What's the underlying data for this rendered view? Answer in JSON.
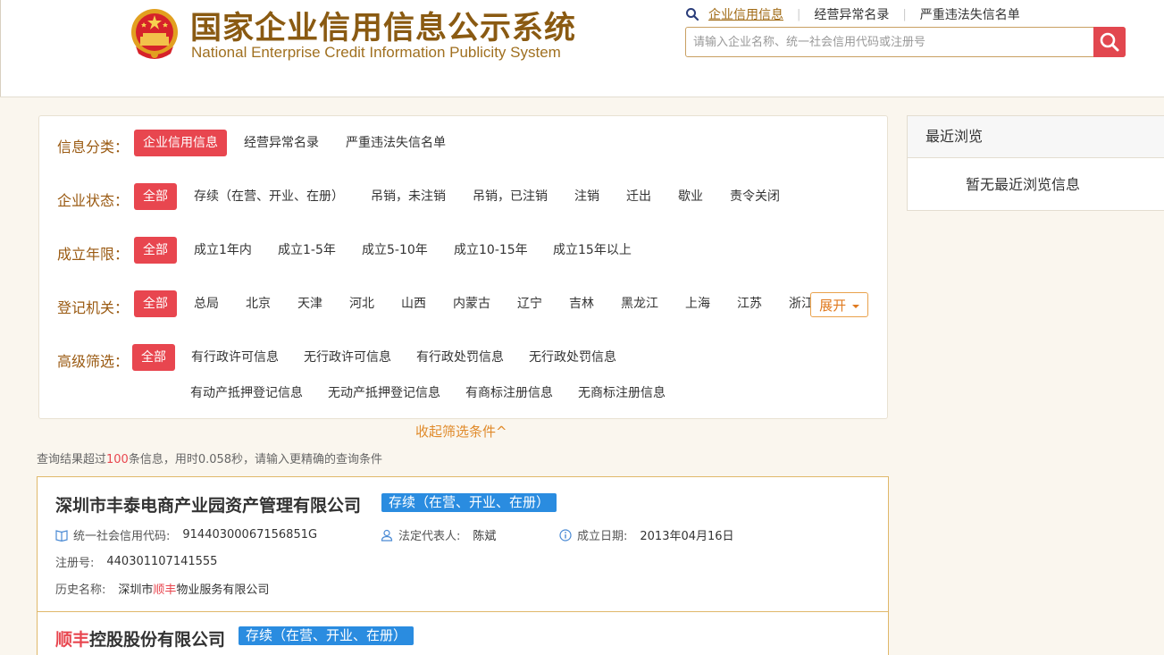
{
  "header": {
    "title_cn": "国家企业信用信息公示系统",
    "title_en": "National Enterprise Credit Information Publicity System",
    "nav": [
      {
        "label": "企业信用信息",
        "active": true
      },
      {
        "label": "经营异常名录",
        "active": false
      },
      {
        "label": "严重违法失信名单",
        "active": false
      }
    ],
    "search_placeholder": "请输入企业名称、统一社会信用代码或注册号",
    "colors": {
      "brand": "#8a5a12",
      "accent": "#e2474f"
    }
  },
  "filters": {
    "rows": [
      {
        "label": "信息分类：",
        "chips": [
          "企业信用信息",
          "经营异常名录",
          "严重违法失信名单"
        ],
        "selected": 0
      },
      {
        "label": "企业状态：",
        "chips": [
          "全部",
          "存续（在营、开业、在册）",
          "吊销，未注销",
          "吊销，已注销",
          "注销",
          "迁出",
          "歇业",
          "责令关闭"
        ],
        "selected": 0
      },
      {
        "label": "成立年限：",
        "chips": [
          "全部",
          "成立1年内",
          "成立1-5年",
          "成立5-10年",
          "成立10-15年",
          "成立15年以上"
        ],
        "selected": 0
      },
      {
        "label": "登记机关：",
        "chips": [
          "全部",
          "总局",
          "北京",
          "天津",
          "河北",
          "山西",
          "内蒙古",
          "辽宁",
          "吉林",
          "黑龙江",
          "上海",
          "江苏",
          "浙江"
        ],
        "selected": 0
      },
      {
        "label": "高级筛选：",
        "chips": [
          "全部",
          "有行政许可信息",
          "无行政许可信息",
          "有行政处罚信息",
          "无行政处罚信息",
          "有动产抵押登记信息",
          "无动产抵押登记信息",
          "有商标注册信息",
          "无商标注册信息"
        ],
        "selected": 0
      }
    ],
    "expand_label": "展开",
    "collapse_label": "收起筛选条件^"
  },
  "summary": {
    "prefix": "查询结果超过",
    "count": "100",
    "suffix": "条信息，用时0.058秒，请输入更精确的查询条件"
  },
  "recent": {
    "title": "最近浏览",
    "empty": "暂无最近浏览信息"
  },
  "results": [
    {
      "name": "深圳市丰泰电商产业园资产管理有限公司",
      "status": "存续（在营、开业、在册）",
      "credit_code_label": "统一社会信用代码:",
      "credit_code": "91440300067156851G",
      "legal_rep_label": "法定代表人:",
      "legal_rep": "陈斌",
      "found_date_label": "成立日期:",
      "found_date": "2013年04月16日",
      "reg_no_label": "注册号:",
      "reg_no": "440301107141555",
      "former_name_label": "历史名称:",
      "former_name_pre": "深圳市",
      "former_name_hl": "顺丰",
      "former_name_post": "物业服务有限公司"
    },
    {
      "name_hl": "顺丰",
      "name_rest": "控股股份有限公司",
      "status": "存续（在营、开业、在册）"
    }
  ]
}
